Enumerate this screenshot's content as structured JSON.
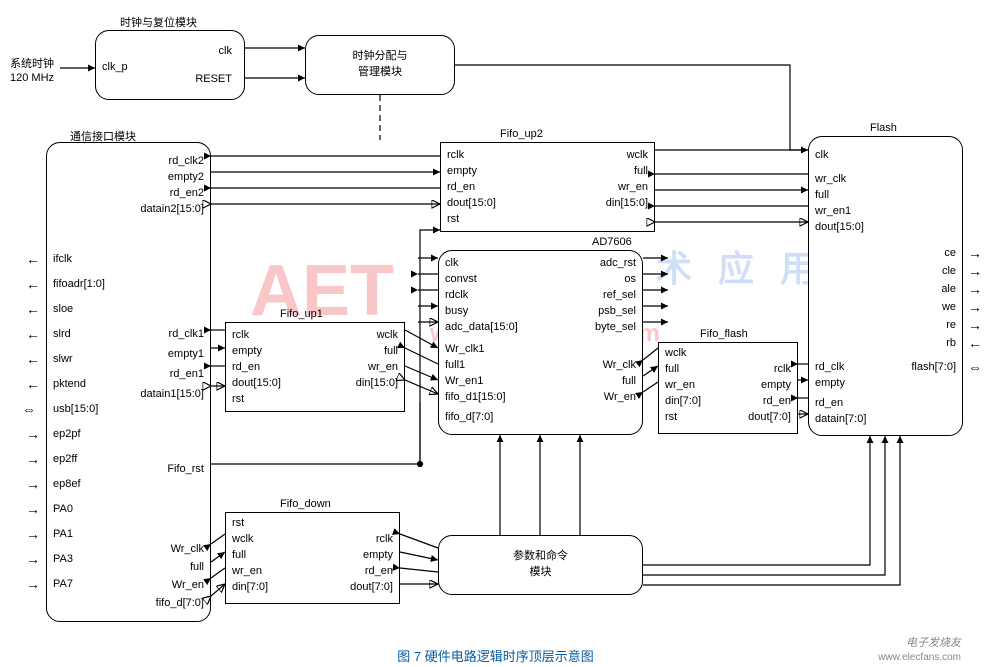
{
  "external": {
    "sys_clock_title": "系统时钟",
    "sys_clock_freq": "120 MHz"
  },
  "clk_reset_module": {
    "title": "时钟与复位模块",
    "in": {
      "clk_p": "clk_p"
    },
    "out": {
      "clk": "clk",
      "reset": "RESET"
    }
  },
  "clk_dist_module": {
    "title_line1": "时钟分配与",
    "title_line2": "管理模块"
  },
  "comm_module": {
    "title": "通信接口模块",
    "left": {
      "ifclk": "ifclk",
      "fifoadr": "fifoadr[1:0]",
      "sloe": "sloe",
      "slrd": "slrd",
      "slwr": "slwr",
      "pktend": "pktend",
      "usb": "usb[15:0]",
      "ep2pf": "ep2pf",
      "ep2ff": "ep2ff",
      "ep8ef": "ep8ef",
      "pa0": "PA0",
      "pa1": "PA1",
      "pa3": "PA3",
      "pa7": "PA7"
    },
    "right": {
      "rd_clk2": "rd_clk2",
      "empty2": "empty2",
      "rd_en2": "rd_en2",
      "datain2": "datain2[15:0]",
      "rd_clk1": "rd_clk1",
      "empty1": "empty1",
      "rd_en1": "rd_en1",
      "datain1": "datain1[15:0]",
      "fifo_rst": "Fifo_rst",
      "wr_clk": "Wr_clk",
      "full": "full",
      "wr_en": "Wr_en",
      "fifo_d": "fifo_d[7:0]"
    }
  },
  "fifo_up1": {
    "title": "Fifo_up1",
    "left": {
      "rclk": "rclk",
      "empty": "empty",
      "rd_en": "rd_en",
      "dout": "dout[15:0]",
      "rst": "rst"
    },
    "right": {
      "wclk": "wclk",
      "full": "full",
      "wr_en": "wr_en",
      "din": "din[15:0]"
    }
  },
  "fifo_up2": {
    "title": "Fifo_up2",
    "left": {
      "rclk": "rclk",
      "empty": "empty",
      "rd_en": "rd_en",
      "dout": "dout[15:0]",
      "rst": "rst"
    },
    "right": {
      "wclk": "wclk",
      "full": "full",
      "wr_en": "wr_en",
      "din": "din[15:0]"
    }
  },
  "fifo_down": {
    "title": "Fifo_down",
    "left": {
      "rst": "rst",
      "wclk": "wclk",
      "full": "full",
      "wr_en": "wr_en",
      "din": "din[7:0]"
    },
    "right": {
      "rclk": "rclk",
      "empty": "empty",
      "rd_en": "rd_en",
      "dout": "dout[7:0]"
    }
  },
  "ad7606": {
    "title": "AD7606",
    "left": {
      "clk": "clk",
      "convst": "convst",
      "rdclk": "rdclk",
      "busy": "busy",
      "adc_data": "adc_data[15:0]",
      "wr_clk1": "Wr_clk1",
      "full1": "full1",
      "wr_en1": "Wr_en1",
      "fifo_d1": "fifo_d1[15:0]",
      "fifo_d": "fifo_d[7:0]"
    },
    "right": {
      "adc_rst": "adc_rst",
      "os": "os",
      "ref_sel": "ref_sel",
      "psb_sel": "psb_sel",
      "byte_sel": "byte_sel",
      "wr_clk": "Wr_clk",
      "full": "full",
      "wr_en": "Wr_en"
    }
  },
  "fifo_flash": {
    "title": "Fifo_flash",
    "left": {
      "wclk": "wclk",
      "full": "full",
      "wr_en": "wr_en",
      "din": "din[7:0]",
      "rst": "rst"
    },
    "right": {
      "rclk": "rclk",
      "empty": "empty",
      "rd_en": "rd_en",
      "dout": "dout[7:0]"
    }
  },
  "flash": {
    "title": "Flash",
    "left": {
      "clk": "clk",
      "wr_clk": "wr_clk",
      "full": "full",
      "wr_en1": "wr_en1",
      "dout": "dout[15:0]",
      "rd_clk": "rd_clk",
      "empty": "empty",
      "rd_en": "rd_en",
      "datain": "datain[7:0]"
    },
    "right": {
      "ce": "ce",
      "cle": "cle",
      "ale": "ale",
      "we": "we",
      "re": "re",
      "rb": "rb",
      "flash_bus": "flash[7:0]"
    }
  },
  "param_cmd": {
    "title_line1": "参数和命令",
    "title_line2": "模块"
  },
  "caption": "图 7  硬件电路逻辑时序顶层示意图",
  "watermark": {
    "aet": "AET",
    "url": "www.ChinaAET.com",
    "cn": "电 子 技 术 应 用",
    "footer": "电子发烧友",
    "footer_url": "www.elecfans.com"
  }
}
